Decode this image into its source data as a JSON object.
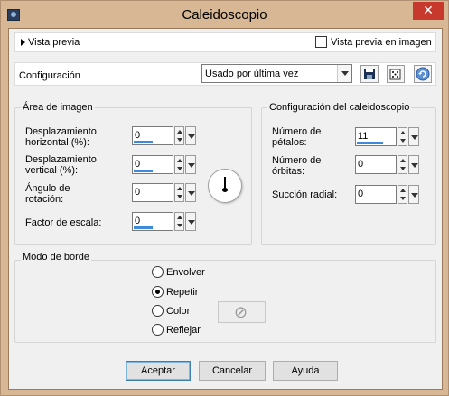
{
  "window": {
    "title": "Caleidoscopio",
    "close_glyph": "✕"
  },
  "preview": {
    "label": "Vista previa",
    "checkbox_label": "Vista previa en imagen",
    "checked": false
  },
  "config": {
    "label": "Configuración",
    "preset": "Usado por última vez",
    "icons": [
      "save-icon",
      "random-dice-icon",
      "reset-icon"
    ]
  },
  "image_area": {
    "title": "Área de imagen",
    "fields": [
      {
        "label": "Desplazamiento horizontal (%):",
        "value": "0",
        "slider": 0.5
      },
      {
        "label": "Desplazamiento vertical (%):",
        "value": "0",
        "slider": 0.5
      },
      {
        "label": "Ángulo de rotación:",
        "value": "0",
        "slider": 0
      },
      {
        "label": "Factor de escala:",
        "value": "0",
        "slider": 0.5
      }
    ],
    "dial_angle_deg": 0
  },
  "kaleido": {
    "title": "Configuración del caleidoscopio",
    "fields": [
      {
        "label": "Número de pétalos:",
        "value": "11",
        "slider": 0.7
      },
      {
        "label": "Número de órbitas:",
        "value": "0",
        "slider": 0
      },
      {
        "label": "Succión radial:",
        "value": "0",
        "slider": 0
      }
    ]
  },
  "border_mode": {
    "title": "Modo de borde",
    "options": [
      {
        "label": "Envolver",
        "selected": false
      },
      {
        "label": "Repetir",
        "selected": true
      },
      {
        "label": "Color",
        "selected": false
      },
      {
        "label": "Reflejar",
        "selected": false
      }
    ],
    "color_disabled_glyph": "⊘"
  },
  "buttons": {
    "ok": "Aceptar",
    "cancel": "Cancelar",
    "help": "Ayuda"
  }
}
